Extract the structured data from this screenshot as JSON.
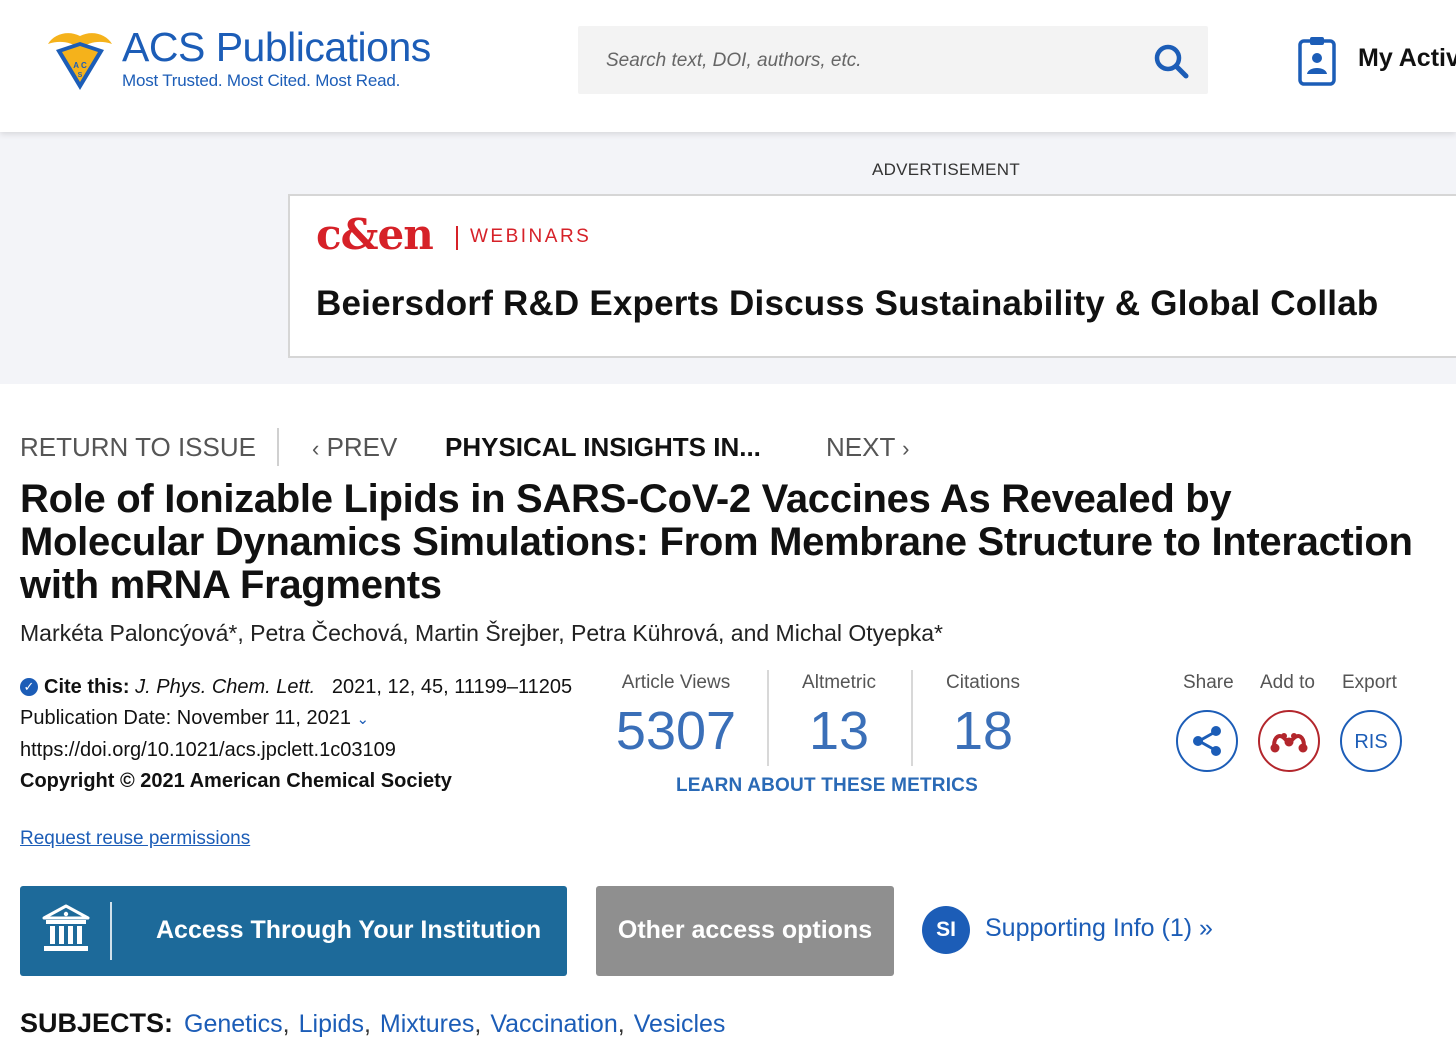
{
  "header": {
    "logo_title": "ACS Publications",
    "logo_tagline": "Most Trusted. Most Cited. Most Read.",
    "search_placeholder": "Search text, DOI, authors, etc.",
    "my_activity": "My Activ"
  },
  "advertisement": {
    "label": "ADVERTISEMENT",
    "brand": "c&en",
    "category": "WEBINARS",
    "headline": "Beiersdorf R&D Experts Discuss Sustainability & Global Collab"
  },
  "nav": {
    "return": "RETURN TO ISSUE",
    "prev": "PREV",
    "current": "PHYSICAL INSIGHTS IN...",
    "next": "NEXT"
  },
  "article": {
    "title": "Role of Ionizable Lipids in SARS-CoV-2 Vaccines As Revealed by Molecular Dynamics Simulations: From Membrane Structure to Interaction with mRNA Fragments",
    "authors": "Markéta Paloncýová*, Petra Čechová, Martin Šrejber, Petra Kührová, and Michal Otyepka*",
    "cite_label": "Cite this:",
    "journal": "J. Phys. Chem. Lett.",
    "citation_detail": "2021, 12, 45, 11199–11205",
    "publication_date": "Publication Date: November 11, 2021",
    "doi": "https://doi.org/10.1021/acs.jpclett.1c03109",
    "copyright": "Copyright © 2021 American Chemical Society",
    "reuse_link": "Request reuse permissions"
  },
  "metrics": {
    "views_label": "Article Views",
    "views": "5307",
    "altmetric_label": "Altmetric",
    "altmetric": "13",
    "citations_label": "Citations",
    "citations": "18",
    "learn_link": "LEARN ABOUT THESE METRICS"
  },
  "tools": {
    "share_label": "Share",
    "add_label": "Add to",
    "export_label": "Export",
    "ris": "RIS"
  },
  "access": {
    "institution_button": "Access Through Your Institution",
    "other_button": "Other access options",
    "si_badge": "SI",
    "supporting_info": "Supporting Info (1) »"
  },
  "subjects": {
    "label": "SUBJECTS:",
    "items": [
      "Genetics",
      "Lipids",
      "Mixtures",
      "Vaccination",
      "Vesicles"
    ]
  },
  "colors": {
    "acs_blue": "#1c5db7",
    "metric_blue": "#3a6fb8",
    "institution_button": "#1d6a9a",
    "other_button": "#8f8f8f",
    "cen_red": "#d62128",
    "mendeley_red": "#b3262c",
    "ad_background": "#f3f4f8"
  }
}
